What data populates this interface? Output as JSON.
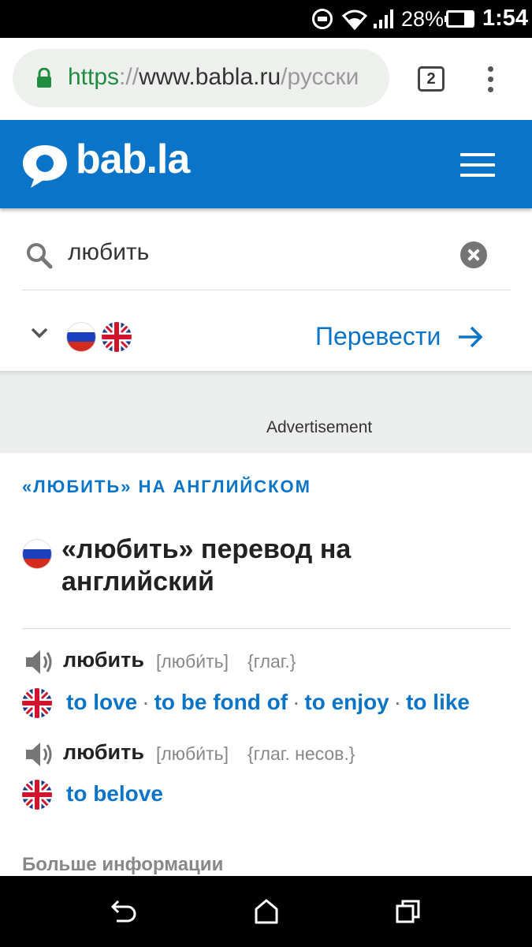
{
  "status_bar": {
    "battery": "28%",
    "time": "1:54",
    "icons": [
      "do-not-disturb-icon",
      "wifi-icon",
      "signal-icon",
      "battery-icon"
    ]
  },
  "browser": {
    "url_scheme": "https",
    "url_sep": "://",
    "url_host": "www.babla.ru",
    "url_path": "/русски",
    "tab_count": "2"
  },
  "site": {
    "logo": "bab.la",
    "brand_color": "#0a74c8"
  },
  "search": {
    "query": "любить",
    "translate_label": "Перевести"
  },
  "ad": {
    "label": "Advertisement"
  },
  "content": {
    "section_heading": "«ЛЮБИТЬ» НА АНГЛИЙСКОМ",
    "title": "«любить» перевод на английский",
    "entries": [
      {
        "word": "любить",
        "transcription": "[люби́ть]",
        "pos": "{глаг.}",
        "translations": [
          "to love",
          "to be fond of",
          "to enjoy",
          "to like"
        ]
      },
      {
        "word": "любить",
        "transcription": "[люби́ть]",
        "pos": "{глаг. несов.}",
        "translations": [
          "to belove"
        ]
      }
    ],
    "more_info": "Больше информации"
  }
}
